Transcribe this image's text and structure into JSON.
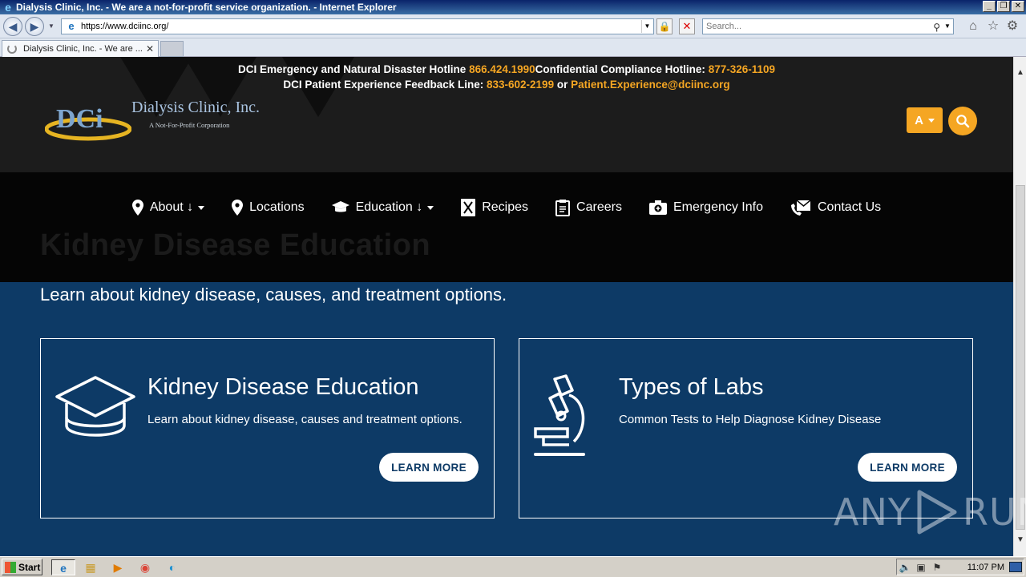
{
  "window": {
    "title": "Dialysis Clinic, Inc. - We are a not-for-profit service organization. - Internet Explorer",
    "buttons": [
      "_",
      "❐",
      "✕"
    ]
  },
  "browser": {
    "url": "https://www.dciinc.org/",
    "search_placeholder": "Search...",
    "tab_title": "Dialysis Clinic, Inc. - We are ..."
  },
  "header": {
    "hotline_1_label": "DCI Emergency and Natural Disaster Hotline",
    "hotline_1_number": "866.424.1990",
    "hotline_2_label": "Confidential Compliance Hotline:",
    "hotline_2_number": "877-326-1109",
    "feedback_label": "DCI Patient Experience Feedback Line:",
    "feedback_number": "833-602-2199",
    "feedback_or": "or",
    "feedback_email": "Patient.Experience@dciinc.org",
    "logo_mark": "DCi",
    "logo_name": "Dialysis Clinic, Inc.",
    "logo_tagline": "A Not-For-Profit Corporation",
    "accessibility_label": "A"
  },
  "nav": {
    "items": [
      {
        "label": "About ↓",
        "icon": "map-pin-icon",
        "dropdown": true
      },
      {
        "label": "Locations",
        "icon": "map-pin-icon",
        "dropdown": false
      },
      {
        "label": "Education ↓",
        "icon": "graduation-cap-icon",
        "dropdown": true
      },
      {
        "label": "Recipes",
        "icon": "utensils-icon",
        "dropdown": false
      },
      {
        "label": "Careers",
        "icon": "clipboard-icon",
        "dropdown": false
      },
      {
        "label": "Emergency Info",
        "icon": "first-aid-icon",
        "dropdown": false
      },
      {
        "label": "Contact Us",
        "icon": "phone-envelope-icon",
        "dropdown": false
      }
    ]
  },
  "page": {
    "heading": "Kidney Disease Education",
    "subtitle": "Learn about kidney disease, causes, and treatment options.",
    "cards": [
      {
        "icon": "graduation-cap-icon",
        "title": "Kidney Disease Education",
        "description": "Learn about kidney disease, causes and treatment options.",
        "button": "LEARN MORE"
      },
      {
        "icon": "microscope-icon",
        "title": "Types of Labs",
        "description": "Common Tests to Help Diagnose Kidney Disease",
        "button": "LEARN MORE"
      }
    ]
  },
  "watermark": {
    "left": "ANY",
    "right": "RUN"
  },
  "taskbar": {
    "start_label": "Start",
    "clock": "11:07 PM"
  },
  "colors": {
    "accent": "#f5a623",
    "header_bg": "#1c1c1c",
    "nav_bg": "#050505",
    "content_bg": "#0d3a66"
  }
}
